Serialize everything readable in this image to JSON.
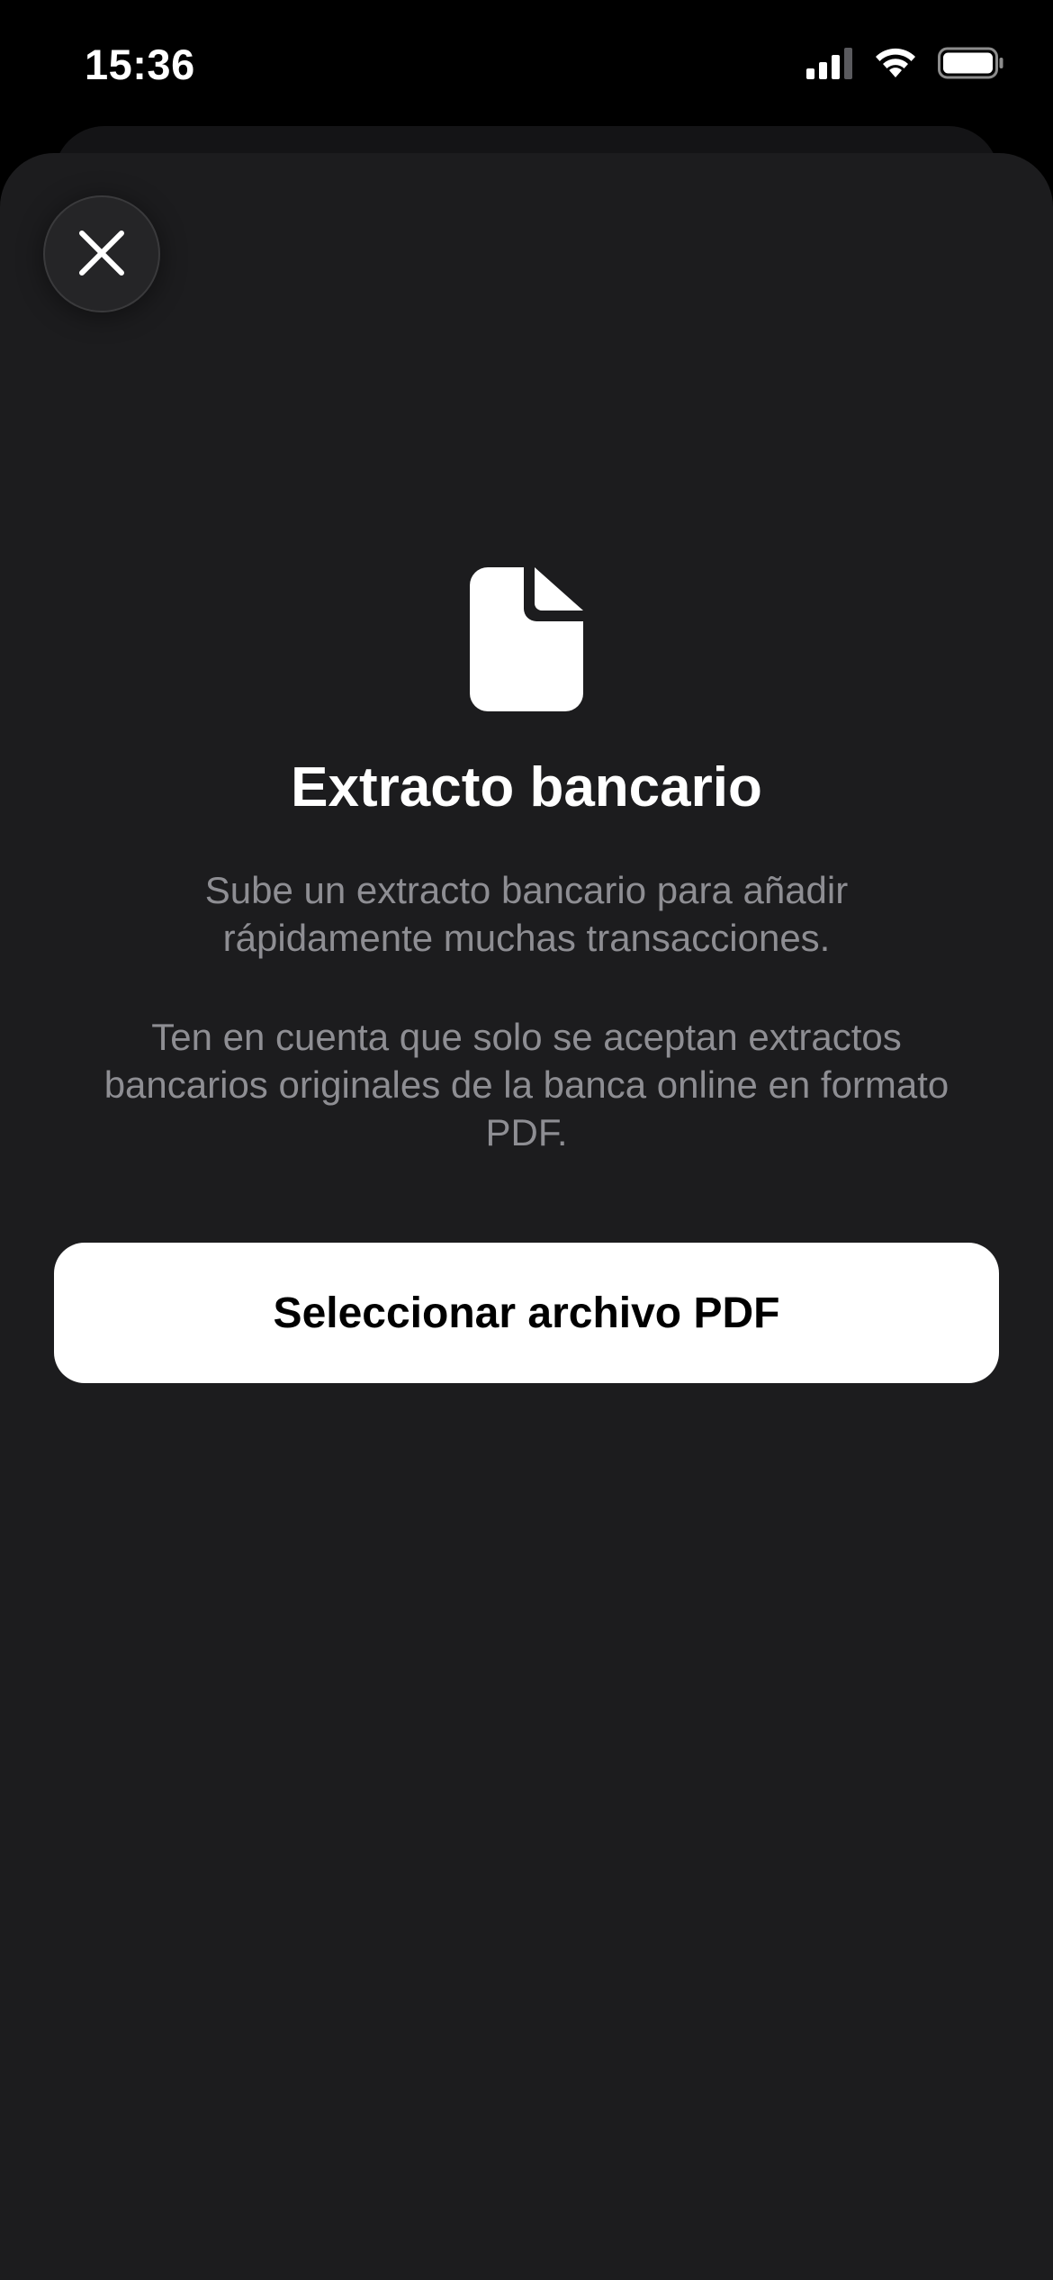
{
  "status_bar": {
    "time": "15:36",
    "signal_icon": "cellular-signal-icon",
    "wifi_icon": "wifi-icon",
    "battery_icon": "battery-icon"
  },
  "sheet": {
    "close_icon": "close-icon",
    "document_icon": "document-icon",
    "title": "Extracto bancario",
    "description": "Sube un extracto bancario para añadir rápidamente muchas transacciones.",
    "note": "Ten en cuenta que solo se aceptan extractos bancarios originales de la banca online en formato PDF.",
    "select_button_label": "Seleccionar archivo PDF"
  },
  "colors": {
    "background": "#000000",
    "sheet": "#1c1c1e",
    "text_primary": "#ffffff",
    "text_secondary": "#8e8e93",
    "button_bg": "#ffffff",
    "button_text": "#000000"
  }
}
